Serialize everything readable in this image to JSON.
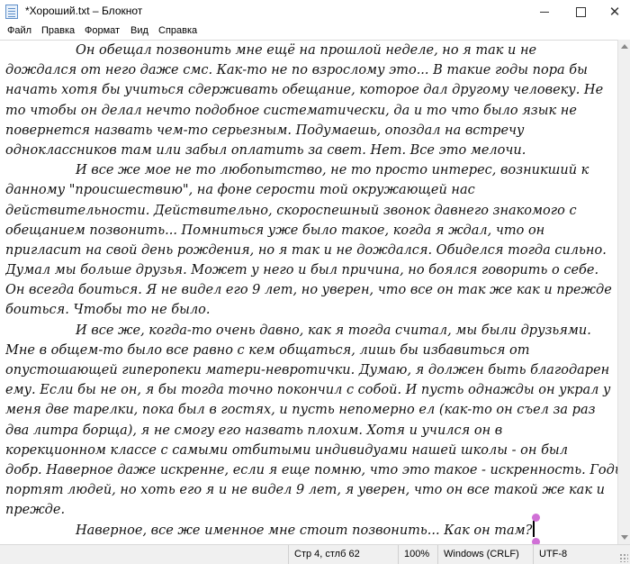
{
  "window": {
    "title": "*Хороший.txt – Блокнот",
    "min_label": "—",
    "max_label": "□",
    "close_label": "✕"
  },
  "menu": [
    "Файл",
    "Правка",
    "Формат",
    "Вид",
    "Справка"
  ],
  "document": {
    "lines": [
      "Он обещал позвонить мне ещё на прошлой неделе, но я так и не",
      "дождался от него даже смс. Как-то не по взрослому это... В такие годы пора бы",
      "начать хотя бы учиться сдерживать обещание, которое дал другому человеку. Не",
      "то чтобы он делал нечто подобное систематически, да и то что было язык не",
      "повернется назвать чем-то серьезным. Подумаешь, опоздал на встречу",
      "одноклассников там или забыл оплатить за свет. Нет. Все это мелочи.",
      "И все же мое не то любопытство, не то просто интерес, возникший к",
      "данному \"происшествию\",  на фоне серости той окружающей нас",
      "действительности. Действительно, скороспешный звонок давнего знакомого с",
      "обещанием позвонить... Помниться уже было такое, когда я ждал, что он",
      "пригласит на свой день рождения, но я так и не дождался. Обиделся тогда сильно.",
      "Думал мы больше друзья. Может у него и был причина, но боялся говорить о себе.",
      "Он всегда боиться. Я не видел его 9 лет,  но уверен, что все он так же как и прежде",
      "боиться. Чтобы то не было.",
      "И все же, когда-то очень давно, как я тогда считал,  мы были друзьями.",
      "Мне в общем-то было все равно с кем общаться, лишь бы избавиться от",
      "опустошающей гиперопеки матери-невротички. Думаю, я должен быть благодарен",
      "ему. Если бы не он, я бы тогда точно покончил с собой. И пусть однажды он украл у",
      "меня две тарелки, пока был в гостях, и пусть непомерно ел (как-то он съел за раз",
      "два литра борща), я не смогу его назвать плохим. Хотя и учился он в",
      "корекционном классе с самыми отбитыми индивидуами нашей школы - он был",
      "добр. Наверное даже искренне, если я еще помню, что это такое - искренность. Годы",
      "портят людей, но хоть его я и не видел 9 лет, я уверен, что он все такой же как и",
      "прежде.",
      "Наверное, все же именное мне стоит позвонить... Как он там?"
    ],
    "para_starts": [
      0,
      6,
      14,
      24
    ]
  },
  "status": {
    "position": "Стр 4, стлб 62",
    "zoom": "100%",
    "line_endings": "Windows (CRLF)",
    "encoding": "UTF-8"
  }
}
